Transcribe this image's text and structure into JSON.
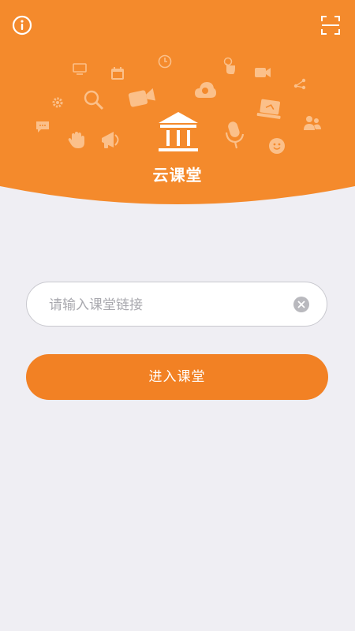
{
  "app": {
    "title": "云课堂"
  },
  "colors": {
    "header_orange": "#f48a2c",
    "button_orange": "#f28124",
    "background": "#efeef3"
  },
  "icons": {
    "info": "info-icon",
    "scan": "scan-icon",
    "logo": "institution-icon"
  },
  "form": {
    "link_input": {
      "placeholder": "请输入课堂链接",
      "value": ""
    },
    "enter_button_label": "进入课堂"
  }
}
